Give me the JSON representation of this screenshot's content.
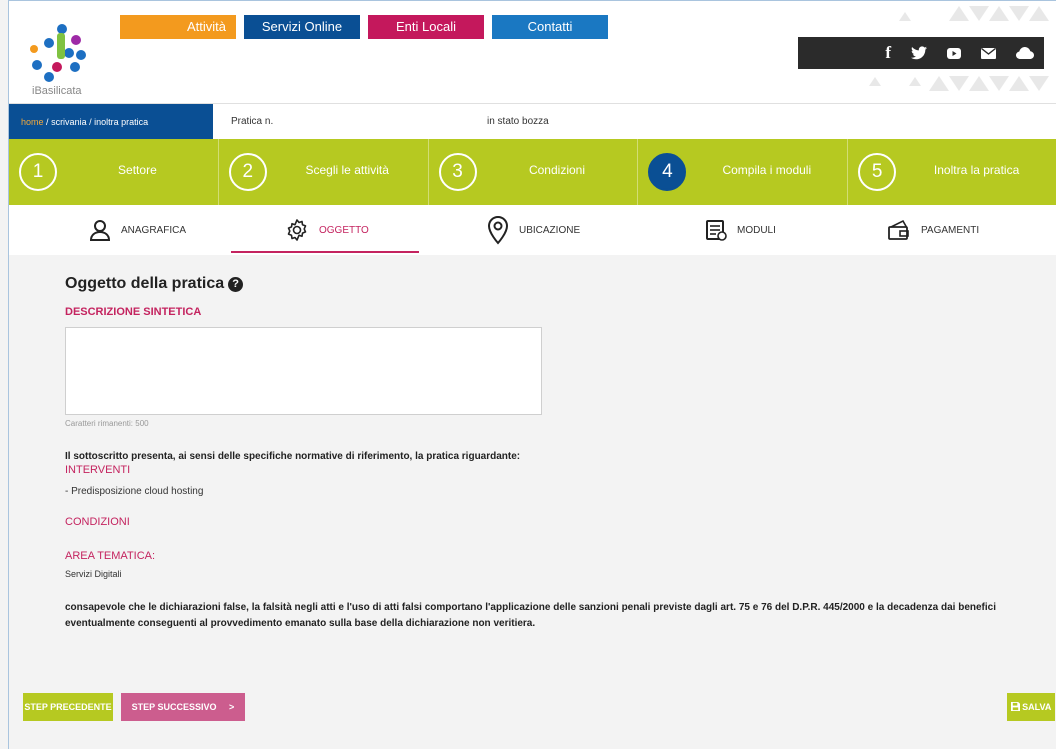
{
  "brand": {
    "logo_text": "iBasilicata"
  },
  "topnav": [
    {
      "label": "Attività",
      "color": "#f39a1e"
    },
    {
      "label": "Servizi Online",
      "color": "#0a4f94"
    },
    {
      "label": "Enti Locali",
      "color": "#c4185c"
    },
    {
      "label": "Contatti",
      "color": "#1a78c2"
    }
  ],
  "social": {
    "facebook": "f",
    "twitter": "twitter-icon",
    "youtube": "youtube-icon",
    "email": "envelope-icon",
    "cloud": "cloud-icon"
  },
  "breadcrumb": {
    "home": "home",
    "sep": "/",
    "scrivania": "scrivania",
    "inoltra": "inoltra pratica"
  },
  "pratica": {
    "label": "Pratica n.",
    "stato": "in stato bozza"
  },
  "steps": [
    {
      "num": "1",
      "label": "Settore"
    },
    {
      "num": "2",
      "label": "Scegli le attività"
    },
    {
      "num": "3",
      "label": "Condizioni"
    },
    {
      "num": "4",
      "label": "Compila i moduli"
    },
    {
      "num": "5",
      "label": "Inoltra la pratica"
    }
  ],
  "tabs": [
    {
      "label": "ANAGRAFICA",
      "icon": "user-icon"
    },
    {
      "label": "OGGETTO",
      "icon": "gear-icon"
    },
    {
      "label": "UBICAZIONE",
      "icon": "location-pin-icon"
    },
    {
      "label": "MODULI",
      "icon": "document-icon"
    },
    {
      "label": "PAGAMENTI",
      "icon": "wallet-icon"
    }
  ],
  "content": {
    "title": "Oggetto della pratica",
    "descr_label": "DESCRIZIONE SINTETICA",
    "descr_value": "",
    "counter": "Caratteri rimanenti: 500",
    "presenta": "Il sottoscritto presenta, ai sensi delle specifiche normative di riferimento, la pratica riguardante:",
    "interventi_label": "INTERVENTI",
    "intervento": "- Predisposizione cloud hosting",
    "condizioni_label": "CONDIZIONI",
    "area_label": "AREA TEMATICA:",
    "area_value": "Servizi Digitali",
    "disclaimer": "consapevole che le dichiarazioni false, la falsità negli atti e l'uso di atti falsi comportano l'applicazione delle sanzioni penali previste dagli art. 75 e 76 del D.P.R. 445/2000 e la decadenza dai benefici eventualmente conseguenti al provvedimento emanato sulla base della dichiarazione non veritiera."
  },
  "buttons": {
    "prev": "STEP PRECEDENTE",
    "next": "STEP SUCCESSIVO",
    "next_arrow": ">",
    "save": "SALVA"
  },
  "colors": {
    "lime": "#b6c921",
    "navy": "#0a4f94",
    "pink": "#c4235f"
  }
}
